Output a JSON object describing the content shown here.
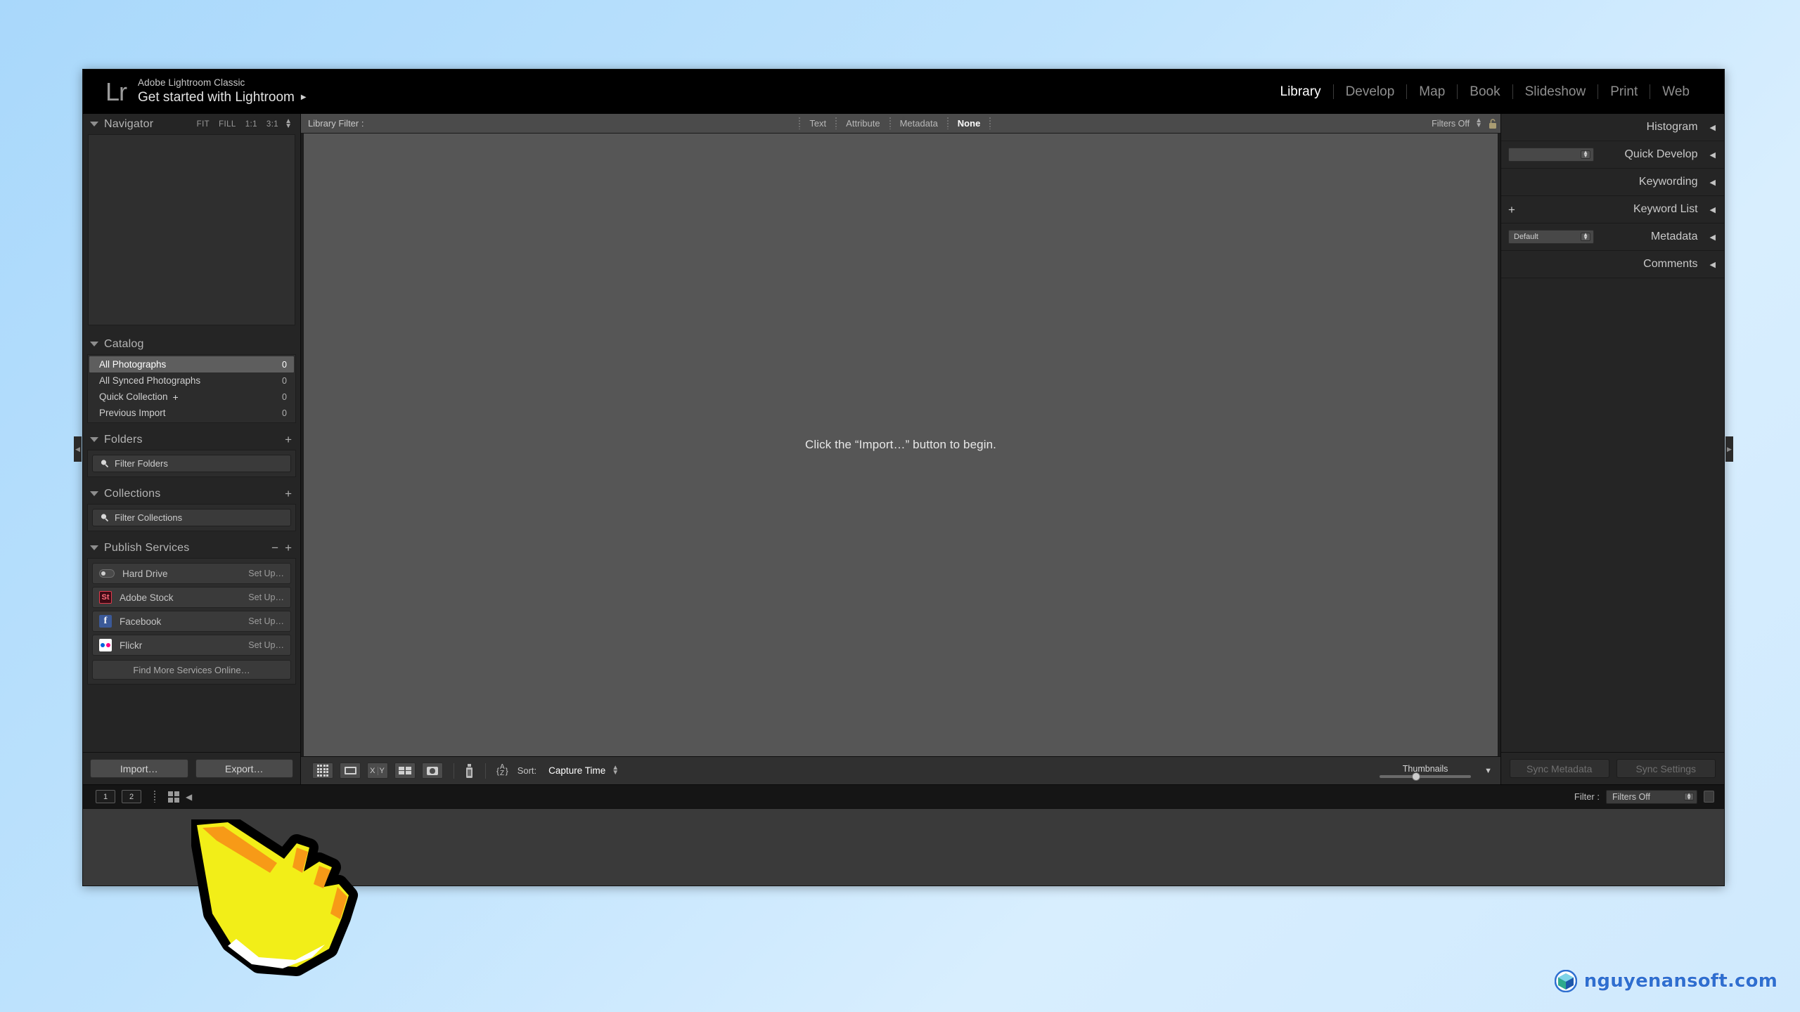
{
  "app": {
    "logo": "Lr",
    "subtitle": "Adobe Lightroom Classic",
    "title": "Get started with Lightroom",
    "title_caret": "▶"
  },
  "modules": [
    {
      "label": "Library",
      "active": true
    },
    {
      "label": "Develop",
      "active": false
    },
    {
      "label": "Map",
      "active": false
    },
    {
      "label": "Book",
      "active": false
    },
    {
      "label": "Slideshow",
      "active": false
    },
    {
      "label": "Print",
      "active": false
    },
    {
      "label": "Web",
      "active": false
    }
  ],
  "left_panel": {
    "navigator": {
      "title": "Navigator",
      "zoom_levels": [
        "FIT",
        "FILL",
        "1:1",
        "3:1"
      ]
    },
    "catalog": {
      "title": "Catalog",
      "items": [
        {
          "label": "All Photographs",
          "count": "0",
          "selected": true
        },
        {
          "label": "All Synced Photographs",
          "count": "0",
          "selected": false
        },
        {
          "label": "Quick Collection",
          "plus": "+",
          "count": "0",
          "selected": false
        },
        {
          "label": "Previous Import",
          "count": "0",
          "selected": false
        }
      ]
    },
    "folders": {
      "title": "Folders",
      "filter_placeholder": "Filter Folders"
    },
    "collections": {
      "title": "Collections",
      "filter_placeholder": "Filter Collections"
    },
    "publish_services": {
      "title": "Publish Services",
      "items": [
        {
          "label": "Hard Drive",
          "action": "Set Up…",
          "icon": "hard-drive-icon"
        },
        {
          "label": "Adobe Stock",
          "action": "Set Up…",
          "icon": "adobe-stock-icon",
          "glyph": "St"
        },
        {
          "label": "Facebook",
          "action": "Set Up…",
          "icon": "facebook-icon",
          "glyph": "f"
        },
        {
          "label": "Flickr",
          "action": "Set Up…",
          "icon": "flickr-icon"
        }
      ],
      "find_more": "Find More Services Online…"
    },
    "footer": {
      "import_label": "Import…",
      "export_label": "Export…"
    }
  },
  "library_filter": {
    "label": "Library Filter :",
    "tabs": [
      {
        "label": "Text",
        "active": false
      },
      {
        "label": "Attribute",
        "active": false
      },
      {
        "label": "Metadata",
        "active": false
      },
      {
        "label": "None",
        "active": true
      }
    ],
    "filters_state": "Filters Off",
    "lock_icon": "unlocked-padlock-icon"
  },
  "content": {
    "message": "Click the “Import…” button to begin."
  },
  "toolbar": {
    "view_modes": [
      {
        "name": "grid-view-icon"
      },
      {
        "name": "loupe-view-icon"
      },
      {
        "name": "compare-view-icon"
      },
      {
        "name": "survey-view-icon"
      },
      {
        "name": "people-view-icon"
      }
    ],
    "spray_icon": "spray-can-icon",
    "sort_direction_icon": "a-z-sort-icon",
    "sort_az_top": "A",
    "sort_az_bottom": "Z",
    "sort_label": "Sort:",
    "sort_value": "Capture Time",
    "thumbnails_label": "Thumbnails",
    "thumbnail_slider_percent": 35
  },
  "right_panel": {
    "rows": [
      {
        "title": "Histogram",
        "caret": "◀",
        "control": "none"
      },
      {
        "title": "Quick Develop",
        "caret": "◀",
        "control": "select",
        "select_value": ""
      },
      {
        "title": "Keywording",
        "caret": "◀",
        "control": "none"
      },
      {
        "title": "Keyword List",
        "caret": "◀",
        "control": "plus",
        "plus": "+"
      },
      {
        "title": "Metadata",
        "caret": "◀",
        "control": "select",
        "select_value": "Default"
      },
      {
        "title": "Comments",
        "caret": "◀",
        "control": "none"
      }
    ],
    "footer": {
      "sync_metadata_label": "Sync Metadata",
      "sync_settings_label": "Sync Settings"
    }
  },
  "filmstrip_bar": {
    "monitor_1": "1",
    "monitor_2": "2",
    "grid_icon": "filmstrip-grid-icon",
    "back_icon": "back-arrow-icon",
    "filter_label": "Filter :",
    "filter_value": "Filters Off"
  },
  "watermark": {
    "text": "nguyenansoft.com",
    "icon": "cube-logo-icon",
    "accent_color": "#2f6fd0"
  },
  "cursor": {
    "icon": "pointing-hand-cursor",
    "fill": "#f2ee18",
    "shade": "#f79a17"
  },
  "colors": {
    "desktop_background": "#b2dcfb",
    "window_background": "#252525",
    "content_background": "#565656",
    "accent_active_text": "#ffffff"
  }
}
